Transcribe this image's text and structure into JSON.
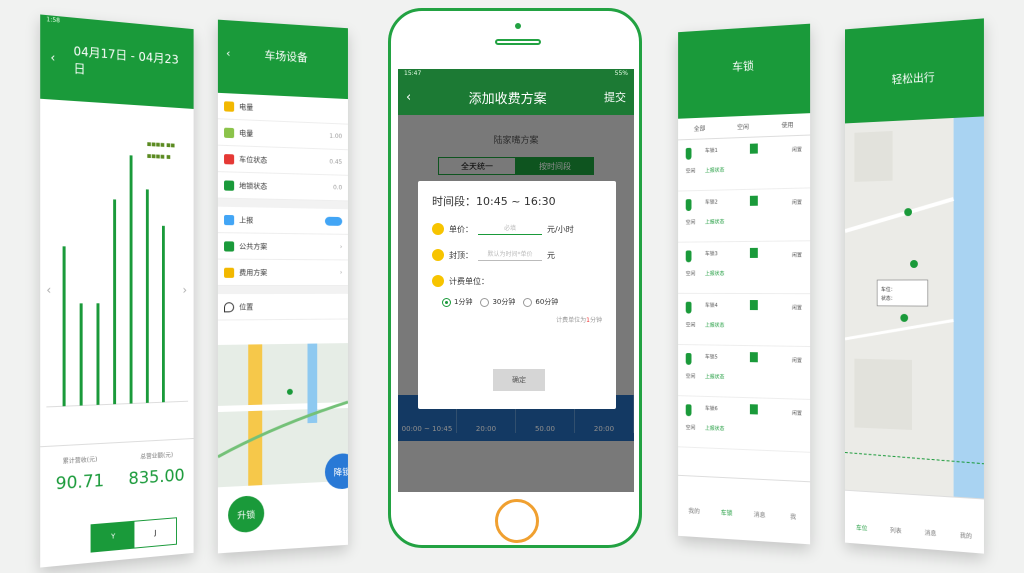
{
  "colors": {
    "brand": "#1a9a3a",
    "accent": "#f0a030",
    "dim": "rgba(0,0,0,.45)",
    "blue": "#2468b4"
  },
  "panel1": {
    "status": "1:58",
    "title": "04月17日 - 04月23日",
    "badges": [
      "■■■■ ■■",
      "■■■■ ■"
    ],
    "summary_left_label": "累计营收(元)",
    "summary_left_value": "90.71",
    "summary_right_label": "总营业额(元)",
    "summary_right_value": "835.00",
    "seg": [
      "Y",
      "J"
    ],
    "chart_data": {
      "type": "bar",
      "values": [
        56,
        36,
        36,
        73,
        89,
        77,
        64
      ],
      "categories": [
        "",
        "",
        "",
        "",
        "",
        "",
        ""
      ]
    }
  },
  "panel2": {
    "title": "车场设备",
    "rows": [
      {
        "label": "电量",
        "value": ""
      },
      {
        "label": "电量",
        "value": "1.00"
      },
      {
        "label": "车位状态",
        "value": "0.45"
      },
      {
        "label": "地锁状态",
        "value": "0.0"
      },
      {
        "label": "上报",
        "value": ""
      },
      {
        "label": "公共方案",
        "value": ""
      },
      {
        "label": "费用方案",
        "value": ""
      },
      {
        "label": "位置",
        "value": ""
      }
    ],
    "fab_left": "升锁",
    "fab_right": "降锁"
  },
  "phone": {
    "status_time": "15:47",
    "status_right": "55%",
    "nav_title": "添加收费方案",
    "nav_submit": "提交",
    "sub_title": "陆家嘴方案",
    "tabs": [
      "全天统一",
      "按时间段"
    ],
    "strip_cells": [
      "00:00 ~ 10:45",
      "20:00",
      "50.00",
      "20:00"
    ],
    "dialog": {
      "title": "时间段：10:45 ~ 16:30",
      "price_label": "单价：",
      "price_placeholder": "必填",
      "price_unit": "元/小时",
      "cap_label": "封顶：",
      "cap_placeholder": "默认为时间*单价",
      "cap_unit": "元",
      "unit_label": "计费单位：",
      "options": [
        "1分钟",
        "30分钟",
        "60分钟"
      ],
      "selected": 0,
      "note_prefix": "计费单位为",
      "note_value": "1",
      "note_suffix": "分钟",
      "ok": "确定"
    }
  },
  "panel4": {
    "title": "车锁",
    "status_tabs": [
      "全部",
      "空闲",
      "使用"
    ],
    "items": [
      {
        "k": "车锁1",
        "s": "上报状态",
        "n": "空闲",
        "v": "闲置"
      },
      {
        "k": "车锁2",
        "s": "上报状态",
        "n": "空闲",
        "v": "闲置"
      },
      {
        "k": "车锁3",
        "s": "上报状态",
        "n": "空闲",
        "v": "闲置"
      },
      {
        "k": "车锁4",
        "s": "上报状态",
        "n": "空闲",
        "v": "闲置"
      },
      {
        "k": "车锁5",
        "s": "上报状态",
        "n": "空闲",
        "v": "闲置"
      },
      {
        "k": "车锁6",
        "s": "上报状态",
        "n": "空闲",
        "v": "闲置"
      }
    ],
    "bnav": [
      "我的",
      "车锁",
      "消息",
      "我"
    ]
  },
  "panel5": {
    "title": "轻松出行",
    "popup_line1": "车位：",
    "popup_line2": "状态：",
    "bnav": [
      "车位",
      "列表",
      "消息",
      "我的"
    ]
  }
}
